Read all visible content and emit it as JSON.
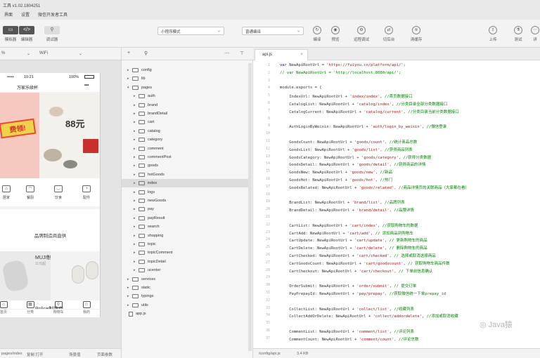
{
  "window": {
    "title": "工具 v1.02.1804251"
  },
  "menu": [
    "界面",
    "设置",
    "微信开发者工具"
  ],
  "toolbar": {
    "left": [
      {
        "name": "simulator",
        "icon": "▭",
        "label": "模拟器"
      },
      {
        "name": "editor",
        "icon": "</>",
        "label": "编辑器"
      },
      {
        "name": "debugger",
        "icon": "⚲",
        "label": "调试器"
      }
    ],
    "mode_select": "小程序模式",
    "compile_select": "普通编译",
    "middle": [
      {
        "name": "compile",
        "icon": "↻",
        "label": "编译"
      },
      {
        "name": "preview",
        "icon": "◉",
        "label": "预览"
      },
      {
        "name": "remote-debug",
        "icon": "⚙",
        "label": "远程调试"
      },
      {
        "name": "background",
        "icon": "⇄",
        "label": "切后台"
      },
      {
        "name": "clear-cache",
        "icon": "≋",
        "label": "清缓存"
      }
    ],
    "right": [
      {
        "name": "upload",
        "icon": "⇪",
        "label": "上传"
      },
      {
        "name": "test",
        "icon": "⚗",
        "label": "测试"
      },
      {
        "name": "details",
        "icon": "⋯",
        "label": "详"
      }
    ]
  },
  "simulator": {
    "zoom": "%",
    "network": "WiFi",
    "status_time": "10:21",
    "status_battery": "100%",
    "nav_title": "万家乐续杯",
    "nav_menu": "•••",
    "banner_tag": "费领!",
    "banner_price": "88元",
    "categories": [
      "居家",
      "餐厨",
      "饮食",
      "配件"
    ],
    "brand_section_title": "品牌制造商直供",
    "brand1_name": "MUJI制造商",
    "brand1_price": "11元起",
    "brand2_name": "Police制造商",
    "tabs": [
      "首页",
      "分类",
      "购物车",
      "我的"
    ],
    "footer_path": "pages/index",
    "footer_param": "复制 打开",
    "footer_scene": "场景值",
    "footer_page": "页面参数"
  },
  "filetree": {
    "items": [
      {
        "label": "config",
        "level": 0,
        "type": "folder",
        "expanded": false
      },
      {
        "label": "lib",
        "level": 0,
        "type": "folder",
        "expanded": false
      },
      {
        "label": "pages",
        "level": 0,
        "type": "folder",
        "expanded": true
      },
      {
        "label": "auth",
        "level": 1,
        "type": "folder",
        "expanded": false
      },
      {
        "label": "brand",
        "level": 1,
        "type": "folder",
        "expanded": false
      },
      {
        "label": "brandDetail",
        "level": 1,
        "type": "folder",
        "expanded": false
      },
      {
        "label": "cart",
        "level": 1,
        "type": "folder",
        "expanded": false
      },
      {
        "label": "catalog",
        "level": 1,
        "type": "folder",
        "expanded": false
      },
      {
        "label": "category",
        "level": 1,
        "type": "folder",
        "expanded": false
      },
      {
        "label": "comment",
        "level": 1,
        "type": "folder",
        "expanded": false
      },
      {
        "label": "commentPost",
        "level": 1,
        "type": "folder",
        "expanded": false
      },
      {
        "label": "goods",
        "level": 1,
        "type": "folder",
        "expanded": false
      },
      {
        "label": "hotGoods",
        "level": 1,
        "type": "folder",
        "expanded": false
      },
      {
        "label": "index",
        "level": 1,
        "type": "folder",
        "expanded": false,
        "selected": true
      },
      {
        "label": "logs",
        "level": 1,
        "type": "folder",
        "expanded": false
      },
      {
        "label": "newGoods",
        "level": 1,
        "type": "folder",
        "expanded": false
      },
      {
        "label": "pay",
        "level": 1,
        "type": "folder",
        "expanded": false
      },
      {
        "label": "payResult",
        "level": 1,
        "type": "folder",
        "expanded": false
      },
      {
        "label": "search",
        "level": 1,
        "type": "folder",
        "expanded": false
      },
      {
        "label": "shopping",
        "level": 1,
        "type": "folder",
        "expanded": false
      },
      {
        "label": "topic",
        "level": 1,
        "type": "folder",
        "expanded": false
      },
      {
        "label": "topicComment",
        "level": 1,
        "type": "folder",
        "expanded": false
      },
      {
        "label": "topicDetail",
        "level": 1,
        "type": "folder",
        "expanded": false
      },
      {
        "label": "ucenter",
        "level": 1,
        "type": "folder",
        "expanded": false
      },
      {
        "label": "services",
        "level": 0,
        "type": "folder",
        "expanded": false
      },
      {
        "label": "static",
        "level": 0,
        "type": "folder",
        "expanded": false
      },
      {
        "label": "typings",
        "level": 0,
        "type": "folder",
        "expanded": false
      },
      {
        "label": "utils",
        "level": 0,
        "type": "folder",
        "expanded": false
      },
      {
        "label": "app.js",
        "level": 0,
        "type": "file",
        "expanded": false
      }
    ]
  },
  "editor": {
    "tab": "api.js",
    "footer_path": "/config/api.js",
    "footer_size": "3.4 KB",
    "lines": [
      {
        "n": 1,
        "parts": [
          [
            "k",
            "var "
          ],
          [
            "t",
            "NewApiRootUrl = "
          ],
          [
            "s",
            "'https://fuiyou.cn/platform/api/'"
          ],
          [
            "t",
            ";"
          ]
        ]
      },
      {
        "n": 2,
        "parts": [
          [
            "c",
            "// var NewApiRootUrl = 'http://localhost:8080/api/';"
          ]
        ]
      },
      {
        "n": 3,
        "parts": []
      },
      {
        "n": 4,
        "parts": [
          [
            "t",
            "module.exports = {"
          ]
        ]
      },
      {
        "n": 5,
        "parts": [
          [
            "t",
            "    IndexUrl: NewApiRootUrl + "
          ],
          [
            "s",
            "'index/index'"
          ],
          [
            "t",
            ", "
          ],
          [
            "c",
            "//首页数据接口"
          ]
        ]
      },
      {
        "n": 6,
        "parts": [
          [
            "t",
            "    CatalogList: NewApiRootUrl + "
          ],
          [
            "s",
            "'catalog/index'"
          ],
          [
            "t",
            ", "
          ],
          [
            "c",
            "//分类目录全部分类数据接口"
          ]
        ]
      },
      {
        "n": 7,
        "parts": [
          [
            "t",
            "    CatalogCurrent: NewApiRootUrl + "
          ],
          [
            "s",
            "'catalog/current'"
          ],
          [
            "t",
            ", "
          ],
          [
            "c",
            "//分类目录当前分类数据接口"
          ]
        ]
      },
      {
        "n": 8,
        "parts": []
      },
      {
        "n": 9,
        "parts": [
          [
            "t",
            "    AuthLoginByWeixin: NewApiRootUrl + "
          ],
          [
            "s",
            "'auth/login_by_weixin'"
          ],
          [
            "t",
            ", "
          ],
          [
            "c",
            "//微信登录"
          ]
        ]
      },
      {
        "n": 10,
        "parts": []
      },
      {
        "n": 11,
        "parts": [
          [
            "t",
            "    GoodsCount: NewApiRootUrl + "
          ],
          [
            "s",
            "'goods/count'"
          ],
          [
            "t",
            ", "
          ],
          [
            "c",
            "//统计商品总数"
          ]
        ]
      },
      {
        "n": 12,
        "parts": [
          [
            "t",
            "    GoodsList: NewApiRootUrl + "
          ],
          [
            "s",
            "'goods/list'"
          ],
          [
            "t",
            ", "
          ],
          [
            "c",
            "//获得商品列表"
          ]
        ]
      },
      {
        "n": 13,
        "parts": [
          [
            "t",
            "    GoodsCategory: NewApiRootUrl + "
          ],
          [
            "s",
            "'goods/category'"
          ],
          [
            "t",
            ", "
          ],
          [
            "c",
            "//获得分类数据"
          ]
        ]
      },
      {
        "n": 14,
        "parts": [
          [
            "t",
            "    GoodsDetail: NewApiRootUrl + "
          ],
          [
            "s",
            "'goods/detail'"
          ],
          [
            "t",
            ", "
          ],
          [
            "c",
            "//获得商品的详情"
          ]
        ]
      },
      {
        "n": 15,
        "parts": [
          [
            "t",
            "    GoodsNew: NewApiRootUrl + "
          ],
          [
            "s",
            "'goods/new'"
          ],
          [
            "t",
            ", "
          ],
          [
            "c",
            "//新品"
          ]
        ]
      },
      {
        "n": 16,
        "parts": [
          [
            "t",
            "    GoodsHot: NewApiRootUrl + "
          ],
          [
            "s",
            "'goods/hot'"
          ],
          [
            "t",
            ", "
          ],
          [
            "c",
            "//热门"
          ]
        ]
      },
      {
        "n": 17,
        "parts": [
          [
            "t",
            "    GoodsRelated: NewApiRootUrl + "
          ],
          [
            "s",
            "'goods/related'"
          ],
          [
            "t",
            ", "
          ],
          [
            "c",
            "//商品详情页的关联商品（大家都在看）"
          ]
        ]
      },
      {
        "n": 18,
        "parts": []
      },
      {
        "n": 19,
        "parts": [
          [
            "t",
            "    BrandList: NewApiRootUrl + "
          ],
          [
            "s",
            "'brand/list'"
          ],
          [
            "t",
            ", "
          ],
          [
            "c",
            "//品牌列表"
          ]
        ]
      },
      {
        "n": 20,
        "parts": [
          [
            "t",
            "    BrandDetail: NewApiRootUrl + "
          ],
          [
            "s",
            "'brand/detail'"
          ],
          [
            "t",
            ", "
          ],
          [
            "c",
            "//品牌详情"
          ]
        ]
      },
      {
        "n": 21,
        "parts": []
      },
      {
        "n": 22,
        "parts": [
          [
            "t",
            "    CartList: NewApiRootUrl + "
          ],
          [
            "s",
            "'cart/index'"
          ],
          [
            "t",
            ", "
          ],
          [
            "c",
            "//获取购物车的数据"
          ]
        ]
      },
      {
        "n": 23,
        "parts": [
          [
            "t",
            "    CartAdd: NewApiRootUrl + "
          ],
          [
            "s",
            "'cart/add'"
          ],
          [
            "t",
            ", "
          ],
          [
            "c",
            "// 添加商品到购物车"
          ]
        ]
      },
      {
        "n": 24,
        "parts": [
          [
            "t",
            "    CartUpdate: NewApiRootUrl + "
          ],
          [
            "s",
            "'cart/update'"
          ],
          [
            "t",
            ", "
          ],
          [
            "c",
            "// 更新购物车的商品"
          ]
        ]
      },
      {
        "n": 25,
        "parts": [
          [
            "t",
            "    CartDelete: NewApiRootUrl + "
          ],
          [
            "s",
            "'cart/delete'"
          ],
          [
            "t",
            ", "
          ],
          [
            "c",
            "// 删除购物车的商品"
          ]
        ]
      },
      {
        "n": 26,
        "parts": [
          [
            "t",
            "    CartChecked: NewApiRootUrl + "
          ],
          [
            "s",
            "'cart/checked'"
          ],
          [
            "t",
            ", "
          ],
          [
            "c",
            "// 选择或取消选择商品"
          ]
        ]
      },
      {
        "n": 27,
        "parts": [
          [
            "t",
            "    CartGoodsCount: NewApiRootUrl + "
          ],
          [
            "s",
            "'cart/goodscount'"
          ],
          [
            "t",
            ", "
          ],
          [
            "c",
            "// 获取购物车商品件数"
          ]
        ]
      },
      {
        "n": 28,
        "parts": [
          [
            "t",
            "    CartCheckout: NewApiRootUrl + "
          ],
          [
            "s",
            "'cart/checkout'"
          ],
          [
            "t",
            ", "
          ],
          [
            "c",
            "// 下单前信息确认"
          ]
        ]
      },
      {
        "n": 29,
        "parts": []
      },
      {
        "n": 30,
        "parts": [
          [
            "t",
            "    OrderSubmit: NewApiRootUrl + "
          ],
          [
            "s",
            "'order/submit'"
          ],
          [
            "t",
            ", "
          ],
          [
            "c",
            "// 提交订单"
          ]
        ]
      },
      {
        "n": 31,
        "parts": [
          [
            "t",
            "    PayPrepayId: NewApiRootUrl + "
          ],
          [
            "s",
            "'pay/prepay'"
          ],
          [
            "t",
            ", "
          ],
          [
            "c",
            "//获取微信统一下单prepay_id"
          ]
        ]
      },
      {
        "n": 32,
        "parts": []
      },
      {
        "n": 33,
        "parts": [
          [
            "t",
            "    CollectList: NewApiRootUrl + "
          ],
          [
            "s",
            "'collect/list'"
          ],
          [
            "t",
            ", "
          ],
          [
            "c",
            "//收藏列表"
          ]
        ]
      },
      {
        "n": 34,
        "parts": [
          [
            "t",
            "    CollectAddOrDelete: NewApiRootUrl + "
          ],
          [
            "s",
            "'collect/addordelete'"
          ],
          [
            "t",
            ", "
          ],
          [
            "c",
            "//添加或取消收藏"
          ]
        ]
      },
      {
        "n": 35,
        "parts": []
      },
      {
        "n": 36,
        "parts": [
          [
            "t",
            "    CommentList: NewApiRootUrl + "
          ],
          [
            "s",
            "'comment/list'"
          ],
          [
            "t",
            ", "
          ],
          [
            "c",
            "//评论列表"
          ]
        ]
      },
      {
        "n": 37,
        "parts": [
          [
            "t",
            "    CommentCount: NewApiRootUrl + "
          ],
          [
            "s",
            "'comment/count'"
          ],
          [
            "t",
            ", "
          ],
          [
            "c",
            "//评论总数"
          ]
        ]
      }
    ]
  },
  "watermark": "Java猿"
}
